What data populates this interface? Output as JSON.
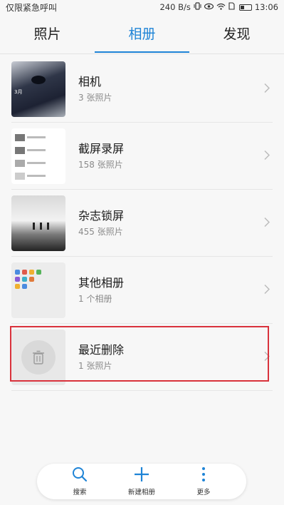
{
  "status_bar": {
    "left_text": "仅限紧急呼叫",
    "net_speed": "240 B/s",
    "time": "13:06"
  },
  "tabs": [
    {
      "label": "照片",
      "active": false
    },
    {
      "label": "相册",
      "active": true
    },
    {
      "label": "发现",
      "active": false
    }
  ],
  "albums": [
    {
      "name": "相机",
      "count": "3 张照片",
      "icon": "camera-thumbnail"
    },
    {
      "name": "截屏录屏",
      "count": "158 张照片",
      "icon": "screenshot-thumbnail"
    },
    {
      "name": "杂志锁屏",
      "count": "455 张照片",
      "icon": "magazine-thumbnail"
    },
    {
      "name": "其他相册",
      "count": "1 个相册",
      "icon": "other-albums-thumbnail"
    },
    {
      "name": "最近删除",
      "count": "1 张照片",
      "icon": "trash-icon"
    }
  ],
  "bottom_bar": {
    "search_label": "搜索",
    "new_album_label": "新建相册",
    "more_label": "更多"
  },
  "colors": {
    "accent": "#1f84d6",
    "highlight": "#d9323c"
  }
}
